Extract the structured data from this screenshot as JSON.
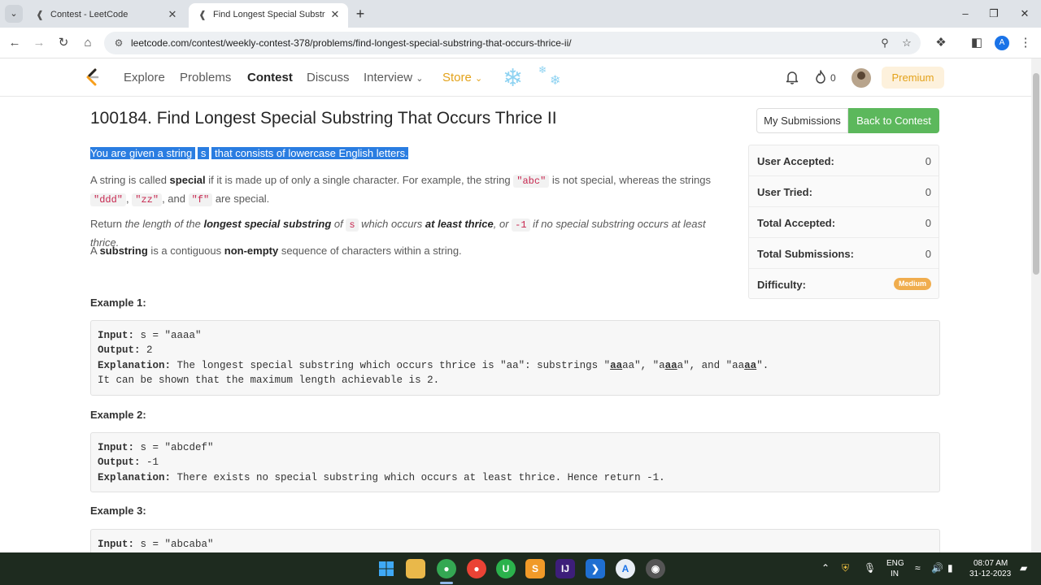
{
  "browser": {
    "tabs": [
      {
        "title": "Contest - LeetCode"
      },
      {
        "title": "Find Longest Special Substring"
      }
    ],
    "url": "leetcode.com/contest/weekly-contest-378/problems/find-longest-special-substring-that-occurs-thrice-ii/",
    "profile_initial": "A"
  },
  "nav": {
    "links": [
      "Explore",
      "Problems",
      "Contest",
      "Discuss",
      "Interview",
      "Store"
    ],
    "streak": "0",
    "premium": "Premium"
  },
  "problem": {
    "title": "100184. Find Longest Special Substring That Occurs Thrice II",
    "my_submissions": "My Submissions",
    "back_to_contest": "Back to Contest",
    "p1": {
      "a": "You are given a string ",
      "code": "s",
      "b": " that consists of lowercase English letters."
    },
    "p2": {
      "a": "A string is called ",
      "b_special": "special",
      "c": " if it is made up of only a single character. For example, the string ",
      "code1": "\"abc\"",
      "d": " is not special, whereas the strings ",
      "code2": "\"ddd\"",
      "e": ", ",
      "code3": "\"zz\"",
      "f": ", and ",
      "code4": "\"f\"",
      "g": " are special."
    },
    "p3": {
      "a": "Return ",
      "i1": "the length of the ",
      "b1": "longest special substring",
      "i2": " of ",
      "code1": "s",
      "i3": " which occurs ",
      "b2": "at least thrice",
      "i4": ", or ",
      "code2": "-1",
      "i5": " if no special substring occurs at least thrice."
    },
    "p4": {
      "a": "A ",
      "b1": "substring",
      "c": " is a contiguous ",
      "b2": "non-empty",
      "d": " sequence of characters within a string."
    }
  },
  "stats": [
    {
      "label": "User Accepted:",
      "value": "0"
    },
    {
      "label": "User Tried:",
      "value": "0"
    },
    {
      "label": "Total Accepted:",
      "value": "0"
    },
    {
      "label": "Total Submissions:",
      "value": "0"
    },
    {
      "label": "Difficulty:",
      "value": "Medium"
    }
  ],
  "examples": [
    {
      "label": "Example 1:",
      "input_label": "Input:",
      "input": " s = \"aaaa\"",
      "output_label": "Output:",
      "output": " 2",
      "expl_label": "Explanation:",
      "expl_a": " The longest special substring which occurs thrice is \"aa\": substrings \"",
      "expl_u1": "aa",
      "expl_b": "aa\", \"a",
      "expl_u2": "aa",
      "expl_c": "a\", and \"aa",
      "expl_u3": "aa",
      "expl_d": "\".",
      "expl_line2": "It can be shown that the maximum length achievable is 2."
    },
    {
      "label": "Example 2:",
      "input_label": "Input:",
      "input": " s = \"abcdef\"",
      "output_label": "Output:",
      "output": " -1",
      "expl_label": "Explanation:",
      "expl_a": " There exists no special substring which occurs at least thrice. Hence return -1."
    },
    {
      "label": "Example 3:",
      "input_label": "Input:",
      "input": " s = \"abcaba\""
    }
  ],
  "taskbar": {
    "lang1": "ENG",
    "lang2": "IN",
    "time": "08:07 AM",
    "date": "31-12-2023"
  },
  "colors": {
    "accent_green": "#5cb85c",
    "store_orange": "#e3a21a",
    "selection": "#2a7de1",
    "medium_badge": "#f0ad4e"
  }
}
